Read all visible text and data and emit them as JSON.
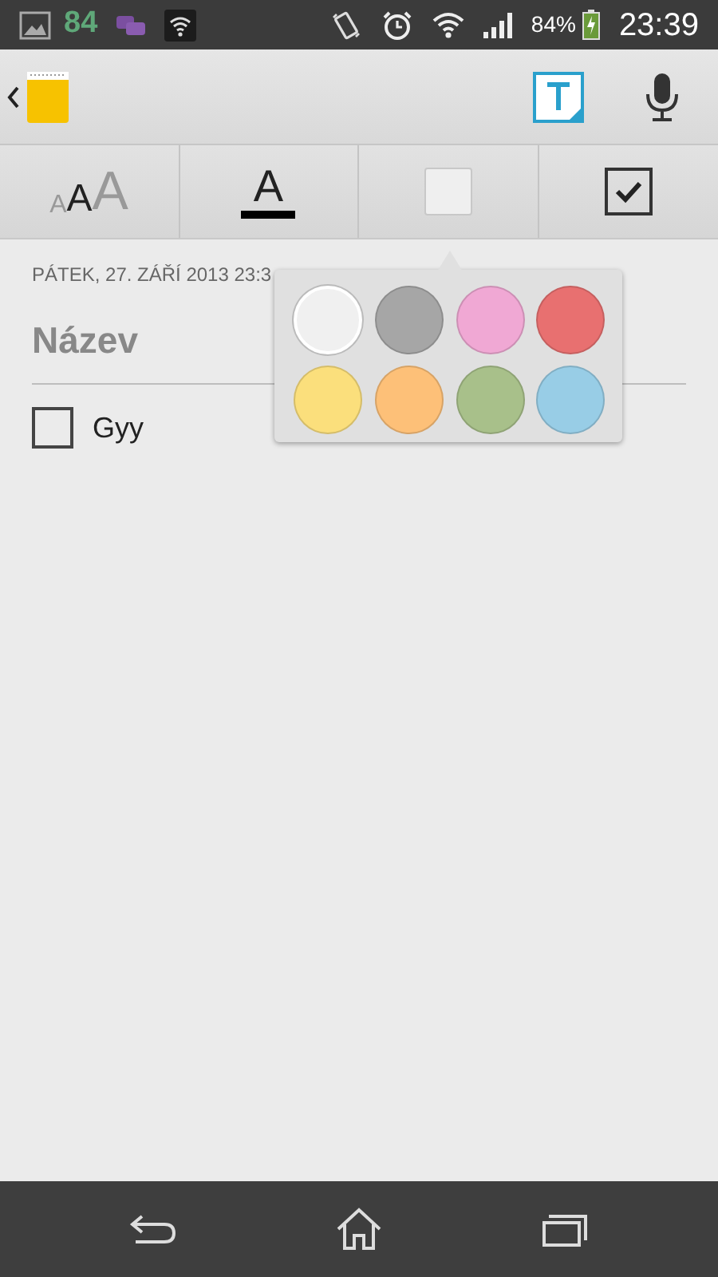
{
  "status_bar": {
    "notification_count": "84",
    "battery": "84%",
    "time": "23:39"
  },
  "format_bar": {
    "text_size_letters": [
      "A",
      "A",
      "A"
    ],
    "text_color_letter": "A"
  },
  "note": {
    "date": "PÁTEK, 27. ZÁŘÍ 2013 23:3",
    "title": "Název",
    "items": [
      {
        "text": "Gyy",
        "checked": false
      }
    ]
  },
  "color_picker": {
    "swatches": [
      {
        "color": "#f0f0f0",
        "selected": true
      },
      {
        "color": "#a6a6a6",
        "selected": false
      },
      {
        "color": "#f0a8d4",
        "selected": false
      },
      {
        "color": "#e87070",
        "selected": false
      },
      {
        "color": "#fbdf7c",
        "selected": false
      },
      {
        "color": "#fdc078",
        "selected": false
      },
      {
        "color": "#a8c08a",
        "selected": false
      },
      {
        "color": "#98cde6",
        "selected": false
      }
    ]
  }
}
